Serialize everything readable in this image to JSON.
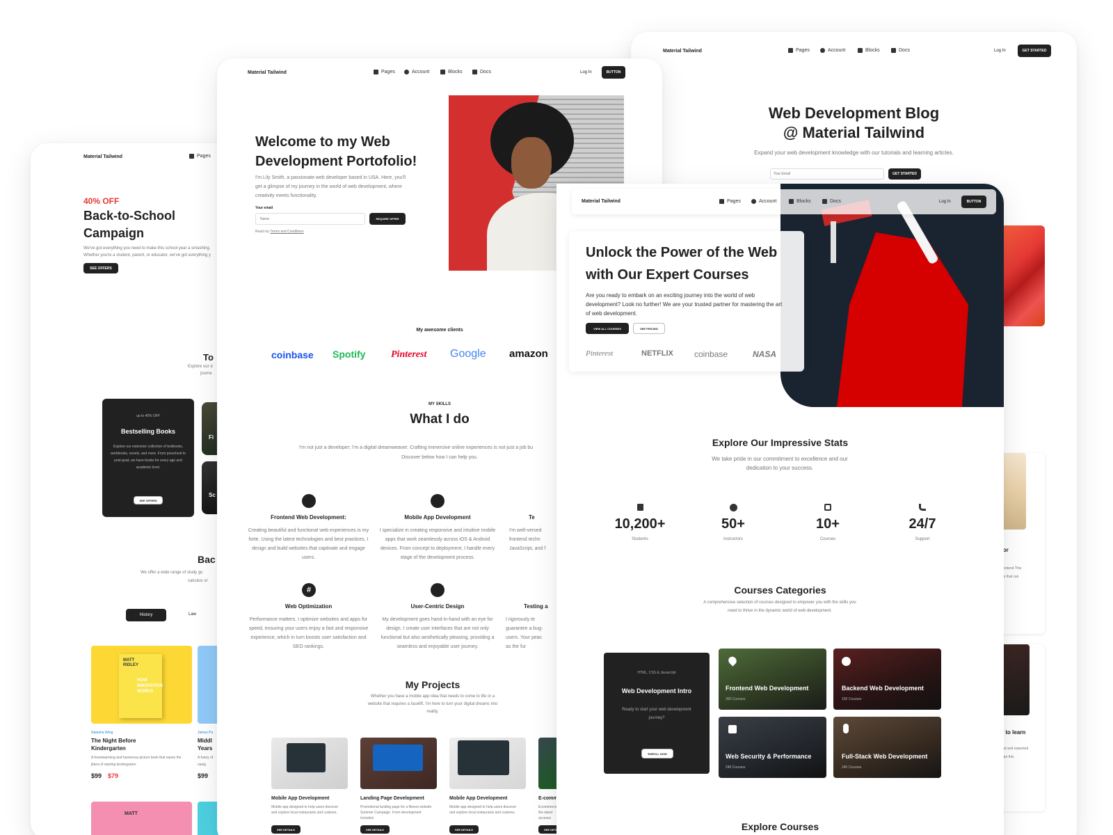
{
  "colors": {
    "accent": "#e53935",
    "dark": "#212121",
    "red": "#d32f2f",
    "yellow": "#fdd835"
  },
  "brand": "Material Tailwind",
  "nav": {
    "pages": "Pages",
    "account": "Account",
    "blocks": "Blocks",
    "docs": "Docs",
    "login": "Log In",
    "button": "BUTTON",
    "get_started": "GET STARTED"
  },
  "left": {
    "discount": "40% OFF",
    "title": "Back-to-School Campaign",
    "desc": "We've got everything you need to make this school year a smashing. Whether you're a student, parent, or educator, we've got everything y",
    "see_offers": "SEE OFFERS",
    "to": "To",
    "to_sub": "Explore our d",
    "to_sub2": "journe",
    "promo_small": "up to 40% OFF",
    "promo_title": "Bestselling Books",
    "promo_desc": "Explore our extensive collection of textbooks, workbooks, novels, and more. From preschool to post-grad, we have books for every age and academic level.",
    "promo_btn": "SEE OFFERS",
    "card_f": "Fi",
    "card_s": "Sc",
    "bac": "Bac",
    "bac_sub": "We offer a wide range of study gu",
    "bac_sub2": "calculus or",
    "tab_history": "History",
    "tab_law": "Law",
    "book_author": "Natasha Wing",
    "book_title": "The Night Before Kindergarten",
    "book_desc": "A heartwarming and humorous picture book that eases the jitters of starting kindergarten",
    "book_price_old": "$99",
    "book_price_new": "$79",
    "cover_text": "MATT RIDLEY",
    "cover_sub": "HOW INNOVATION WORKS",
    "book2_author": "James Pa",
    "book2_title": "Middl Years",
    "book2_desc": "A funny of navig",
    "book2_price": "$99",
    "cover2_text": "MATT"
  },
  "portfolio": {
    "title": "Welcome to my Web Development Portofolio!",
    "desc": "I'm Lily Smith, a passionate web developer based in USA. Here, you'll get a glimpse of my journey in the world of web development, where creativity meets functionality.",
    "email_label": "Your email",
    "email_placeholder": "Name",
    "require_btn": "REQUIRE OFFER",
    "read_prefix": "Read my",
    "read_link": "Terms and Conditions",
    "clients_label": "My awesome clients",
    "clients": [
      "coinbase",
      "Spotify",
      "Pinterest",
      "Google",
      "amazon"
    ],
    "skills_kicker": "MY SKILLS",
    "skills_title": "What I do",
    "skills_desc": "I'm not just a developer; I'm a digital dreamweaver. Crafting immersive online experiences is not just a job bu",
    "skills_desc2": "Discover below how I can help you.",
    "skills": [
      {
        "title": "Frontend Web Development:",
        "desc": "Creating beautiful and functional web experiences is my forte. Using the latest technologies and best practices, I design and build websites that captivate and engage users."
      },
      {
        "title": "Mobile App Development",
        "desc": "I specialize in creating responsive and intuitive mobile apps that work seamlessly across iOS & Android devices. From concept to deployment, I handle every stage of the development process."
      },
      {
        "title": "Te",
        "desc": "I'm well-versed frontend techn JavaScript, and f"
      },
      {
        "title": "Web Optimization",
        "desc": "Performance matters. I optimize websites and apps for speed, ensuring your users enjoy a fast and responsive experience, which in turn boosts user satisfaction and SEO rankings."
      },
      {
        "title": "User-Centric Design",
        "desc": "My development goes hand-in-hand with an eye for design. I create user interfaces that are not only functional but also aesthetically pleasing, providing a seamless and enjoyable user journey."
      },
      {
        "title": "Testing a",
        "desc": "I rigorously te guarantee a bug- users. Your peac as the fur"
      }
    ],
    "projects_title": "My Projects",
    "projects_desc": "Whether you have a mobile app idea that needs to come to life or a website that requires a facelift, I'm here to turn your digital dreams into reality.",
    "projects": [
      {
        "title": "Mobile App Development",
        "desc": "Mobile app designed to help users discover and explore local restaurants and cuisines."
      },
      {
        "title": "Landing Page Development",
        "desc": "Promotional landing page for a fitness website Summer Campaign. Form development included."
      },
      {
        "title": "Mobile App Development",
        "desc": "Mobile app designed to help users discover and explore local restaurants and cuisines."
      },
      {
        "title": "E-comm",
        "desc": "Ecommerce the latest accesso"
      }
    ],
    "see_details": "SEE DETAILS"
  },
  "blog": {
    "title_line1": "Web Development Blog",
    "title_line2": "@ Material Tailwind",
    "desc": "Expand your web development knowledge with our tutorials and learning articles.",
    "email_placeholder": "Your Email",
    "btn": "GET STARTED",
    "frag_with": "with",
    "frag_works": "orks for",
    "frag_works_desc": "rap web frontend This article tools that can ects.",
    "frag_learn": "works to learn",
    "frag_learn_desc": "top frontend and expected to landscape this"
  },
  "courses": {
    "title_line1": "Unlock the Power of the Web",
    "title_line2": "with Our Expert Courses",
    "desc": "Are you ready to embark on an exciting journey into the world of web development? Look no further! We are your trusted partner for mastering the art of web development.",
    "btn_view": "VIEW ALL COURSES",
    "btn_pricing": "SEE PRICING",
    "logos": [
      "Pinterest",
      "NETFLIX",
      "coinbase",
      "NASA"
    ],
    "stats_title": "Explore Our Impressive Stats",
    "stats_desc": "We take pride in our commitment to excellence and our dedication to your success.",
    "stats": [
      {
        "value": "10,200+",
        "label": "Students",
        "icon": "chart-icon"
      },
      {
        "value": "50+",
        "label": "Instructors",
        "icon": "play-icon"
      },
      {
        "value": "10+",
        "label": "Courses",
        "icon": "edit-icon"
      },
      {
        "value": "24/7",
        "label": "Support",
        "icon": "phone-icon"
      }
    ],
    "cat_title": "Courses Categories",
    "cat_desc": "A comprehensive selection of courses designed to empower you with the skills you need to thrive in the dynamic world of web development.",
    "intro_kicker": "HTML, CSS & Javascript",
    "intro_title": "Web Development Intro",
    "intro_desc": "Ready to start your web development journey?",
    "intro_btn": "ENROLL NOW",
    "categories": [
      {
        "title": "Frontend Web Development",
        "count": "300 Courses",
        "icon": "heart-icon"
      },
      {
        "title": "Backend Web Development",
        "count": "100 Courses",
        "icon": "globe-icon"
      },
      {
        "title": "Web Security & Performance",
        "count": "240 Courses",
        "icon": "puzzle-icon"
      },
      {
        "title": "Full-Stack Web Development",
        "count": "240 Courses",
        "icon": "mic-icon"
      }
    ],
    "explore_title": "Explore Courses"
  }
}
